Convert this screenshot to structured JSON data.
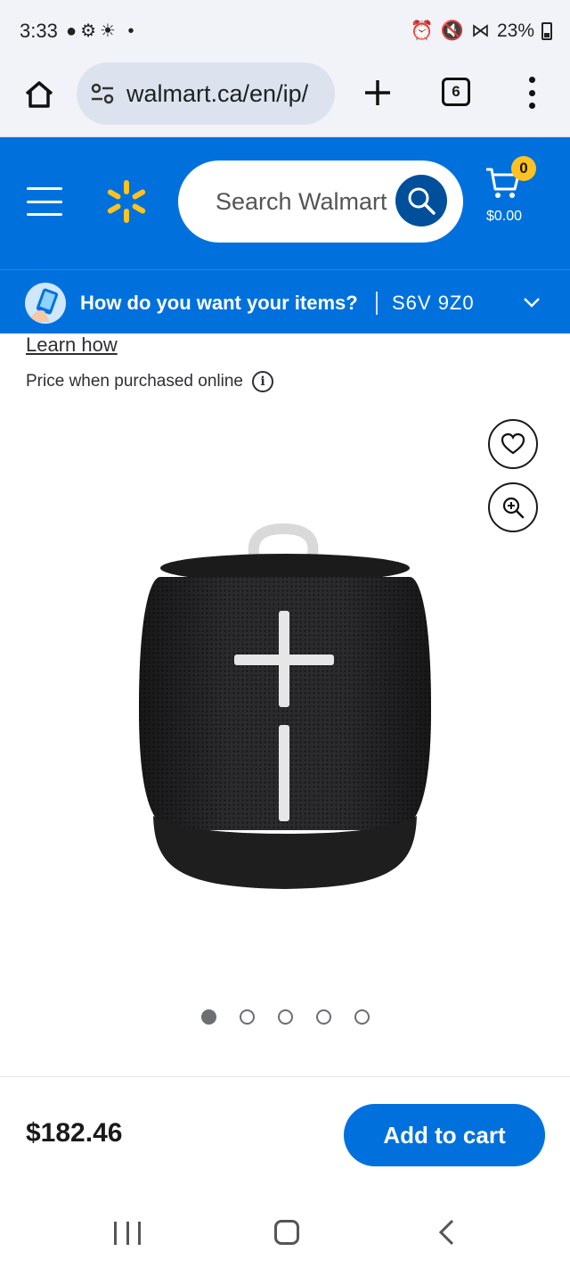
{
  "status_bar": {
    "time": "3:33",
    "battery": "23%"
  },
  "browser": {
    "url": "walmart.ca/en/ip/",
    "tab_count": "6"
  },
  "header": {
    "search_placeholder": "Search Walmart",
    "cart_count": "0",
    "cart_total": "$0.00",
    "brand_color": "#0071dc",
    "spark_color": "#ffc220"
  },
  "delivery": {
    "prompt": "How do you want your items?",
    "postal_code": "S6V 9Z0"
  },
  "content": {
    "learn_how": "Learn how",
    "price_note": "Price when purchased online",
    "info_glyph": "i"
  },
  "carousel": {
    "total": 5,
    "active_index": 0
  },
  "purchase": {
    "price": "$182.46",
    "add_to_cart": "Add to cart"
  },
  "icons": [
    "home-icon",
    "site-settings-icon",
    "new-tab-icon",
    "tab-switcher-icon",
    "overflow-menu-icon",
    "hamburger-menu-icon",
    "walmart-spark-icon",
    "search-icon",
    "cart-icon",
    "chevron-down-icon",
    "info-icon",
    "heart-icon",
    "zoom-in-icon"
  ]
}
